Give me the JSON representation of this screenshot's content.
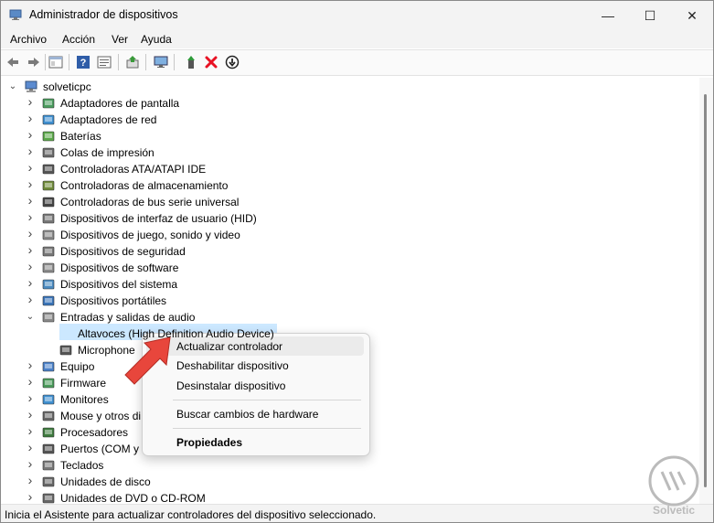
{
  "window": {
    "title": "Administrador de dispositivos",
    "minimize_glyph": "—",
    "maximize_glyph": "☐",
    "close_glyph": "✕"
  },
  "menu": [
    "Archivo",
    "Acción",
    "Ver",
    "Ayuda"
  ],
  "toolbar_icons": [
    "back-icon",
    "forward-icon",
    "show-hide-icon",
    "help-icon",
    "properties-icon",
    "update-driver-icon",
    "monitor-icon",
    "enable-device-icon",
    "uninstall-icon",
    "disable-device-icon"
  ],
  "tree": {
    "root": "solveticpc",
    "items": [
      {
        "label": "Adaptadores de pantalla",
        "icon": "display-adapter-icon",
        "state": "collapsed"
      },
      {
        "label": "Adaptadores de red",
        "icon": "network-adapter-icon",
        "state": "collapsed"
      },
      {
        "label": "Baterías",
        "icon": "battery-icon",
        "state": "collapsed"
      },
      {
        "label": "Colas de impresión",
        "icon": "printer-icon",
        "state": "collapsed"
      },
      {
        "label": "Controladoras ATA/ATAPI IDE",
        "icon": "ide-controller-icon",
        "state": "collapsed"
      },
      {
        "label": "Controladoras de almacenamiento",
        "icon": "storage-controller-icon",
        "state": "collapsed"
      },
      {
        "label": "Controladoras de bus serie universal",
        "icon": "usb-icon",
        "state": "collapsed"
      },
      {
        "label": "Dispositivos de interfaz de usuario (HID)",
        "icon": "hid-icon",
        "state": "collapsed"
      },
      {
        "label": "Dispositivos de juego, sonido y video",
        "icon": "speaker-icon",
        "state": "collapsed"
      },
      {
        "label": "Dispositivos de seguridad",
        "icon": "security-device-icon",
        "state": "collapsed"
      },
      {
        "label": "Dispositivos de software",
        "icon": "software-device-icon",
        "state": "collapsed"
      },
      {
        "label": "Dispositivos del sistema",
        "icon": "system-device-icon",
        "state": "collapsed"
      },
      {
        "label": "Dispositivos portátiles",
        "icon": "portable-device-icon",
        "state": "collapsed"
      },
      {
        "label": "Entradas y salidas de audio",
        "icon": "audio-io-icon",
        "state": "expanded"
      },
      {
        "label": "Altavoces (High Definition Audio Device)",
        "icon": "speaker-device-icon",
        "state": "child",
        "selected": true
      },
      {
        "label": "Microphone",
        "icon": "microphone-icon",
        "state": "child"
      },
      {
        "label": "Equipo",
        "icon": "computer-icon",
        "state": "collapsed"
      },
      {
        "label": "Firmware",
        "icon": "firmware-icon",
        "state": "collapsed"
      },
      {
        "label": "Monitores",
        "icon": "monitor-icon",
        "state": "collapsed"
      },
      {
        "label": "Mouse y otros di",
        "icon": "mouse-icon",
        "state": "collapsed"
      },
      {
        "label": "Procesadores",
        "icon": "processor-icon",
        "state": "collapsed"
      },
      {
        "label": "Puertos (COM y L",
        "icon": "port-icon",
        "state": "collapsed"
      },
      {
        "label": "Teclados",
        "icon": "keyboard-icon",
        "state": "collapsed"
      },
      {
        "label": "Unidades de disco",
        "icon": "disk-drive-icon",
        "state": "collapsed"
      },
      {
        "label": "Unidades de DVD o CD-ROM",
        "icon": "dvd-drive-icon",
        "state": "collapsed"
      }
    ]
  },
  "context_menu": {
    "update": "Actualizar controlador",
    "disable": "Deshabilitar dispositivo",
    "uninstall": "Desinstalar dispositivo",
    "scan": "Buscar cambios de hardware",
    "properties": "Propiedades"
  },
  "status": "Inicia el Asistente para actualizar controladores del dispositivo seleccionado.",
  "watermark": "Solvetic",
  "colors": {
    "selection": "#cce8ff",
    "arrow": "#e8463c",
    "uninstall": "#e81123"
  }
}
